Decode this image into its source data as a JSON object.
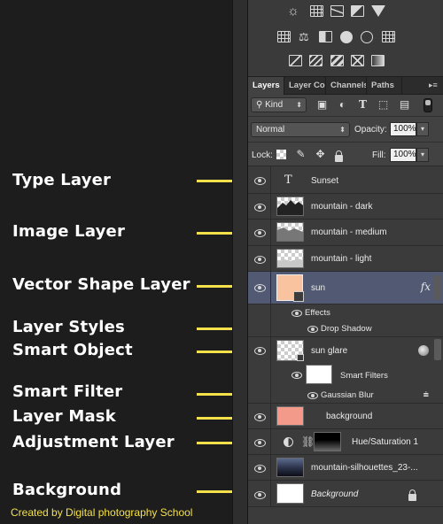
{
  "annotations": [
    {
      "label": "Type Layer"
    },
    {
      "label": "Image Layer"
    },
    {
      "label": "Vector Shape Layer"
    },
    {
      "label": "Layer Styles"
    },
    {
      "label": "Smart Object"
    },
    {
      "label": "Smart Filter"
    },
    {
      "label": "Layer Mask"
    },
    {
      "label": "Adjustment Layer"
    },
    {
      "label": "Background"
    }
  ],
  "credit": "Created by Digital photography School",
  "colors": {
    "arrow": "#f3e04a",
    "selected_row": "#515a72",
    "shape_fill": "#f8c39e"
  },
  "panel": {
    "tabs": [
      "Layers",
      "Layer Co",
      "Channels",
      "Paths"
    ],
    "active_tab": "Layers",
    "filter_kind": "Kind",
    "blend_mode": "Normal",
    "opacity_label": "Opacity:",
    "opacity_value": "100%",
    "lock_label": "Lock:",
    "fill_label": "Fill:",
    "fill_value": "100%",
    "layers": [
      {
        "name": "Sunset",
        "kind": "type",
        "icon": "type-T-icon"
      },
      {
        "name": "mountain - dark",
        "kind": "image"
      },
      {
        "name": "mountain - medium",
        "kind": "image"
      },
      {
        "name": "mountain - light",
        "kind": "image"
      },
      {
        "name": "sun",
        "kind": "shape",
        "fx": "fx",
        "selected": true
      },
      {
        "name": "Effects",
        "kind": "effects-header"
      },
      {
        "name": "Drop Shadow",
        "kind": "effect"
      },
      {
        "name": "sun glare",
        "kind": "smart-object"
      },
      {
        "name": "Smart Filters",
        "kind": "smart-filters"
      },
      {
        "name": "Gaussian Blur",
        "kind": "filter"
      },
      {
        "name": "background",
        "kind": "masked"
      },
      {
        "name": "Hue/Saturation 1",
        "kind": "adjustment"
      },
      {
        "name": "mountain-silhouettes_23-...",
        "kind": "image"
      },
      {
        "name": "Background",
        "kind": "background",
        "locked": true
      }
    ]
  }
}
